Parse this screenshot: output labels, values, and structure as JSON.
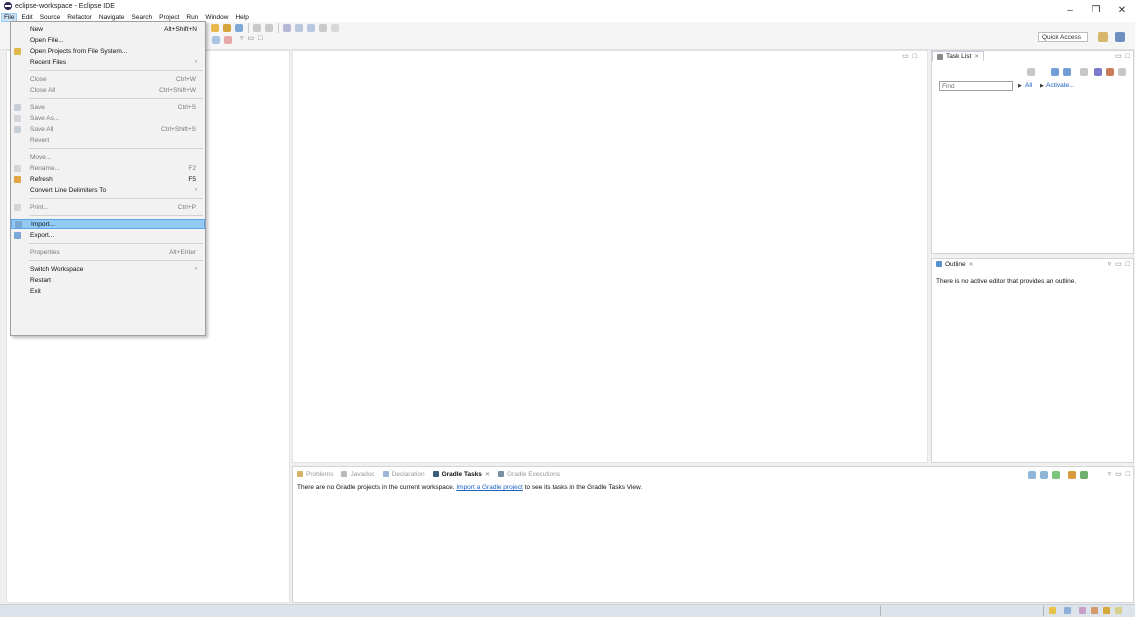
{
  "window": {
    "title": "eclipse-workspace - Eclipse IDE",
    "minimize": "–",
    "maximize": "❐",
    "close": "✕"
  },
  "menubar": [
    "File",
    "Edit",
    "Source",
    "Refactor",
    "Navigate",
    "Search",
    "Project",
    "Run",
    "Window",
    "Help"
  ],
  "toolbar": {
    "quick_access": "Quick Access"
  },
  "file_menu": {
    "new": {
      "label": "New",
      "shortcut": "Alt+Shift+N"
    },
    "open_file": {
      "label": "Open File..."
    },
    "open_projects": {
      "label": "Open Projects from File System..."
    },
    "recent_files": {
      "label": "Recent Files"
    },
    "close": {
      "label": "Close",
      "shortcut": "Ctrl+W"
    },
    "close_all": {
      "label": "Close All",
      "shortcut": "Ctrl+Shift+W"
    },
    "save": {
      "label": "Save",
      "shortcut": "Ctrl+S"
    },
    "save_as": {
      "label": "Save As..."
    },
    "save_all": {
      "label": "Save All",
      "shortcut": "Ctrl+Shift+S"
    },
    "revert": {
      "label": "Revert"
    },
    "move": {
      "label": "Move..."
    },
    "rename": {
      "label": "Rename...",
      "shortcut": "F2"
    },
    "refresh": {
      "label": "Refresh",
      "shortcut": "F5"
    },
    "convert": {
      "label": "Convert Line Delimiters To"
    },
    "print": {
      "label": "Print...",
      "shortcut": "Ctrl+P"
    },
    "import": {
      "label": "Import..."
    },
    "export": {
      "label": "Export..."
    },
    "properties": {
      "label": "Properties",
      "shortcut": "Alt+Enter"
    },
    "switch_workspace": {
      "label": "Switch Workspace"
    },
    "restart": {
      "label": "Restart"
    },
    "exit": {
      "label": "Exit"
    },
    "submenu_arrow": "›"
  },
  "task_list": {
    "tab": "Task List",
    "find_placeholder": "Find",
    "all": "All",
    "activate": "Activate..."
  },
  "outline": {
    "tab": "Outline",
    "message": "There is no active editor that provides an outline."
  },
  "bottom_panel": {
    "tabs": {
      "problems": "Problems",
      "javadoc": "Javadoc",
      "declaration": "Declaration",
      "gradle_tasks": "Gradle Tasks",
      "gradle_executions": "Gradle Executions"
    },
    "message_before": "There are no Gradle projects in the current workspace.",
    "message_link": "Import a Gradle project",
    "message_after": "to see its tasks in the Gradle Tasks View."
  },
  "colors": {
    "menu_highlight": "#91c9f7",
    "link": "#1b5fc1",
    "statusbar": "#dde3ea"
  },
  "icons": {
    "tab_close": "✕",
    "minimize": "▭",
    "maximize": "□",
    "view_menu": "▿"
  }
}
